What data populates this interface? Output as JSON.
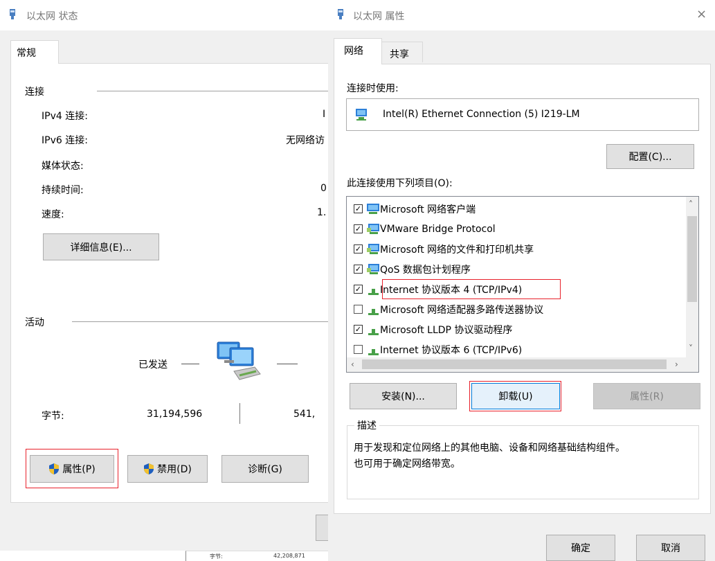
{
  "left_window": {
    "title": "以太网 状态",
    "tab_general": "常规",
    "connection": {
      "heading": "连接",
      "rows": [
        {
          "label": "IPv4 连接:",
          "value": "I"
        },
        {
          "label": "IPv6 连接:",
          "value": "无网络访"
        },
        {
          "label": "媒体状态:",
          "value": ""
        },
        {
          "label": "持续时间:",
          "value": "0"
        },
        {
          "label": "速度:",
          "value": "1."
        }
      ],
      "details_button": "详细信息(E)..."
    },
    "activity": {
      "heading": "活动",
      "sent_label": "已发送",
      "bytes_label": "字节:",
      "bytes_sent": "31,194,596",
      "bytes_received": "541,"
    },
    "buttons": {
      "properties": "属性(P)",
      "disable": "禁用(D)",
      "diagnose": "诊断(G)"
    },
    "background_window": {
      "bytes_label": "字节:",
      "bytes_value": "42,208,871"
    }
  },
  "right_window": {
    "title": "以太网 属性",
    "tabs": [
      "网络",
      "共享"
    ],
    "connect_using_label": "连接时使用:",
    "adapter_name": "Intel(R) Ethernet Connection (5) I219-LM",
    "configure_button": "配置(C)...",
    "items_label": "此连接使用下列项目(O):",
    "items": [
      {
        "label": "Microsoft 网络客户端",
        "checked": true,
        "icon": "network-client-icon"
      },
      {
        "label": "VMware Bridge Protocol",
        "checked": true,
        "icon": "network-service-icon"
      },
      {
        "label": "Microsoft 网络的文件和打印机共享",
        "checked": true,
        "icon": "network-service-icon"
      },
      {
        "label": "QoS 数据包计划程序",
        "checked": true,
        "icon": "network-service-icon"
      },
      {
        "label": "Internet 协议版本 4 (TCP/IPv4)",
        "checked": true,
        "icon": "protocol-icon"
      },
      {
        "label": "Microsoft 网络适配器多路传送器协议",
        "checked": false,
        "icon": "protocol-icon"
      },
      {
        "label": "Microsoft LLDP 协议驱动程序",
        "checked": true,
        "icon": "protocol-icon"
      },
      {
        "label": "Internet 协议版本 6 (TCP/IPv6)",
        "checked": false,
        "icon": "protocol-icon"
      }
    ],
    "install_button": "安装(N)...",
    "uninstall_button": "卸载(U)",
    "properties_button": "属性(R)",
    "description_heading": "描述",
    "description_text_line1": "用于发现和定位网络上的其他电脑、设备和网络基础结构组件。",
    "description_text_line2": "也可用于确定网络带宽。",
    "ok_button": "确定",
    "cancel_button": "取消"
  },
  "colors": {
    "highlight_red": "#e8202a",
    "focus_blue": "#0078d7",
    "window_bg": "#f0f0f0"
  }
}
